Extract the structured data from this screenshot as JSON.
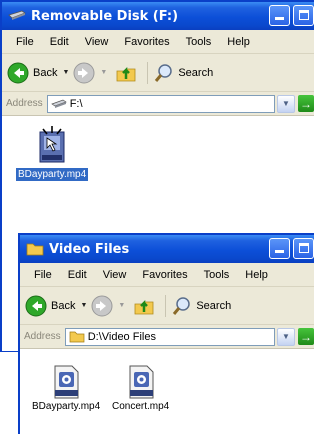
{
  "window1": {
    "title": "Removable Disk (F:)",
    "menu": [
      "File",
      "Edit",
      "View",
      "Favorites",
      "Tools",
      "Help"
    ],
    "toolbar": {
      "back_label": "Back",
      "search_label": "Search"
    },
    "address": {
      "label": "Address",
      "value": "F:\\"
    },
    "files": [
      {
        "name": "BDayparty.mp4",
        "icon": "mp4-file-icon",
        "selected": true
      }
    ]
  },
  "window2": {
    "title": "Video Files",
    "menu": [
      "File",
      "Edit",
      "View",
      "Favorites",
      "Tools",
      "Help"
    ],
    "toolbar": {
      "back_label": "Back",
      "search_label": "Search"
    },
    "address": {
      "label": "Address",
      "value": "D:\\Video Files"
    },
    "files": [
      {
        "name": "BDayparty.mp4",
        "icon": "mp4-file-icon",
        "selected": false
      },
      {
        "name": "Concert.mp4",
        "icon": "mp4-file-icon",
        "selected": false
      }
    ]
  },
  "colors": {
    "titlebar": "#0c4fd8",
    "menubar": "#ece9d8",
    "selection": "#316ac5"
  }
}
